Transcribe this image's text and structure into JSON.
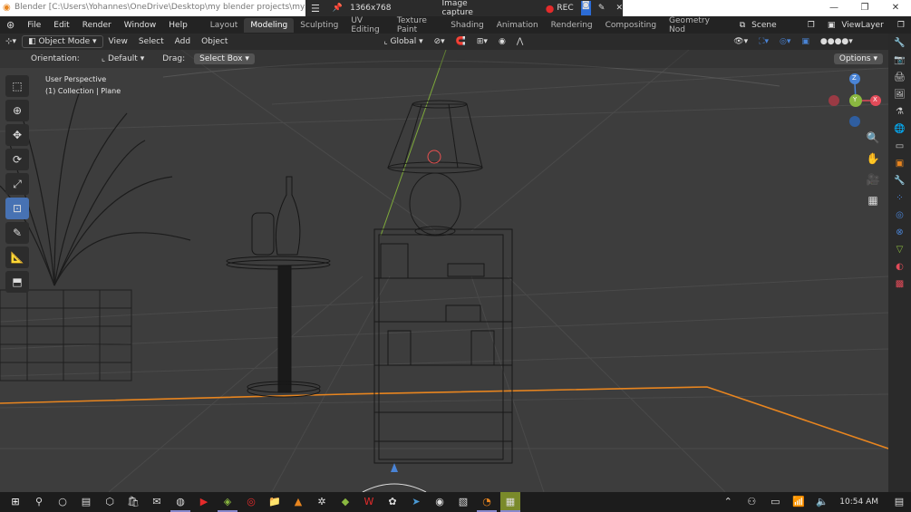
{
  "window": {
    "title": "Blender [C:\\Users\\Yohannes\\OneDrive\\Desktop\\my blender projects\\my project",
    "capture": {
      "resolution": "1366x768",
      "label": "Image capture",
      "rec": "REC"
    }
  },
  "menu": {
    "items": [
      "File",
      "Edit",
      "Render",
      "Window",
      "Help"
    ],
    "workspaces": [
      "Layout",
      "Modeling",
      "Sculpting",
      "UV Editing",
      "Texture Paint",
      "Shading",
      "Animation",
      "Rendering",
      "Compositing",
      "Geometry Nod"
    ],
    "active_workspace": "Modeling",
    "scene": "Scene",
    "view_layer": "ViewLayer"
  },
  "header": {
    "mode": "Object Mode",
    "menus": [
      "View",
      "Select",
      "Add",
      "Object"
    ],
    "transform": "Global"
  },
  "tool_settings": {
    "orientation_label": "Orientation:",
    "orientation_value": "Default",
    "drag_label": "Drag:",
    "drag_value": "Select Box",
    "options": "Options"
  },
  "viewport": {
    "view_name": "User Perspective",
    "collection": "(1) Collection | Plane",
    "gizmo": {
      "z": "Z",
      "x": "X",
      "y": "Y"
    }
  },
  "taskbar": {
    "time": "10:54 AM"
  },
  "colors": {
    "accent": "#4772b3",
    "selection_orange": "#e8851f",
    "rec_red": "#e52b2b",
    "axis_x": "#e24b59",
    "axis_y": "#8ab840",
    "axis_z": "#4a84d6"
  }
}
